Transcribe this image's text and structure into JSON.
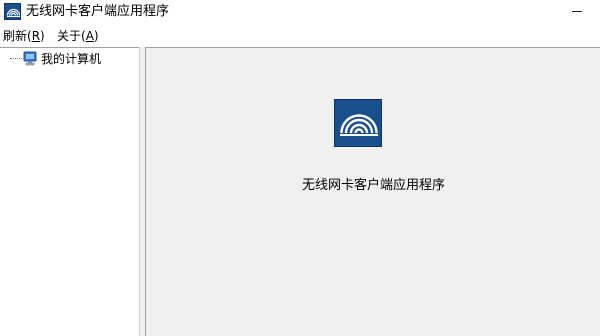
{
  "window": {
    "title": "无线网卡客户端应用程序",
    "icon": "wifi-app-icon",
    "minimize_icon": "minimize-icon"
  },
  "menu": {
    "items": [
      {
        "label_prefix": "刷新(",
        "mnemonic": "R",
        "label_suffix": ")"
      },
      {
        "label_prefix": "关于(",
        "mnemonic": "A",
        "label_suffix": ")"
      }
    ]
  },
  "tree": {
    "root_label": "我的计算机",
    "root_icon": "computer-icon"
  },
  "content": {
    "app_name": "无线网卡客户端应用程序",
    "icon": "wifi-app-icon"
  },
  "colors": {
    "icon_blue": "#1a4f8e",
    "pane_background": "#f0f0f0"
  }
}
